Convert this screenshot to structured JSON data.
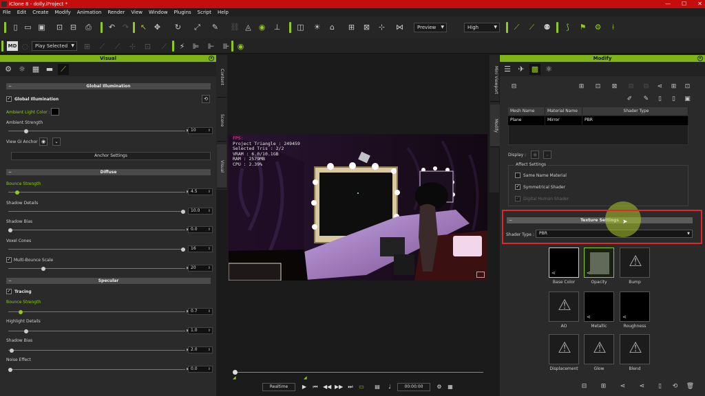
{
  "app": {
    "title": "iClone 8 - dolly.iProject *",
    "window_buttons": [
      "—",
      "☐",
      "✕"
    ]
  },
  "menu": [
    "File",
    "Edit",
    "Create",
    "Modify",
    "Animation",
    "Render",
    "View",
    "Window",
    "Plugins",
    "Script",
    "Help"
  ],
  "toolbar": {
    "preview_select": "Preview",
    "quality_select": "High",
    "play_select": "Play Selected",
    "md_badge": "MD"
  },
  "left_panel": {
    "title": "Visual",
    "vtabs": [
      "Content",
      "Scene",
      "Visual"
    ],
    "global_illumination": {
      "header": "Global Illumination",
      "checkbox_label": "Global Illumination",
      "ambient_color_label": "Ambient Light Color :",
      "ambient_strength_label": "Ambient Strength",
      "ambient_strength_value": "10",
      "ambient_strength_level": 0.1,
      "view_anchor_label": "View GI Anchor",
      "anchor_settings_button": "Anchor Settings"
    },
    "diffuse": {
      "header": "Diffuse",
      "bounce_strength_label": "Bounce Strength",
      "bounce_strength_value": "4.5",
      "bounce_strength_level": 0.05,
      "shadow_details_label": "Shadow Details",
      "shadow_details_value": "10.0",
      "shadow_details_level": 1.0,
      "shadow_bias_label": "Shadow Bias",
      "shadow_bias_value": "0.0",
      "shadow_bias_level": 0.0,
      "voxel_cones_label": "Voxel Cones",
      "voxel_cones_value": "16",
      "voxel_cones_level": 1.0,
      "multi_bounce_label": "Multi-Bounce Scale",
      "multi_bounce_value": "20",
      "multi_bounce_level": 0.2
    },
    "specular": {
      "header": "Specular",
      "tracing_label": "Tracing",
      "bounce_strength_label": "Bounce Strength",
      "bounce_strength_value": "0.7",
      "bounce_strength_level": 0.07,
      "highlight_details_label": "Highlight Details",
      "highlight_details_value": "1.0",
      "highlight_details_level": 0.1,
      "shadow_bias_label": "Shadow Bias",
      "shadow_bias_value": "2.0",
      "shadow_bias_level": 0.02,
      "noise_effect_label": "Noise Effect",
      "noise_effect_value": "0.0",
      "noise_effect_level": 0.0
    }
  },
  "viewport": {
    "hud": {
      "fps": "FPS:",
      "lines": [
        "Project Triangle : 249459",
        "Selected Tris : 2/2",
        "VRAM : 6.0/10.1GB",
        "RAM : 2579MB",
        "CPU : 2.39%"
      ]
    }
  },
  "playback": {
    "mode": "Realtime",
    "timecode": "00:00:00",
    "progress": 0.0
  },
  "right_panel": {
    "title": "Modify",
    "vtabs": [
      "Mini Viewport",
      "Modify"
    ],
    "table": {
      "headers": [
        "Mesh Name",
        "Material Name",
        "Shader Type"
      ],
      "rows": [
        [
          "Plane",
          "Mirror",
          "PBR"
        ]
      ]
    },
    "display_label": "Display :",
    "affect_settings": {
      "label": "Affect Settings",
      "same_name": "Same Name Material",
      "symmetrical": "Symmetrical Shader",
      "digital_human": "Digital Human Shader"
    },
    "texture_settings": {
      "header": "Texture Settings",
      "shader_type_label": "Shader Type :",
      "shader_type_value": "PBR"
    },
    "textures": [
      "Base Color",
      "Opacity",
      "Bump",
      "AO",
      "Metallic",
      "Roughness",
      "Displacement",
      "Glow",
      "Blend"
    ]
  },
  "colors": {
    "accent_green": "#8fcb1f",
    "title_red": "#c50d0d",
    "highlight_red": "#e0282c"
  }
}
